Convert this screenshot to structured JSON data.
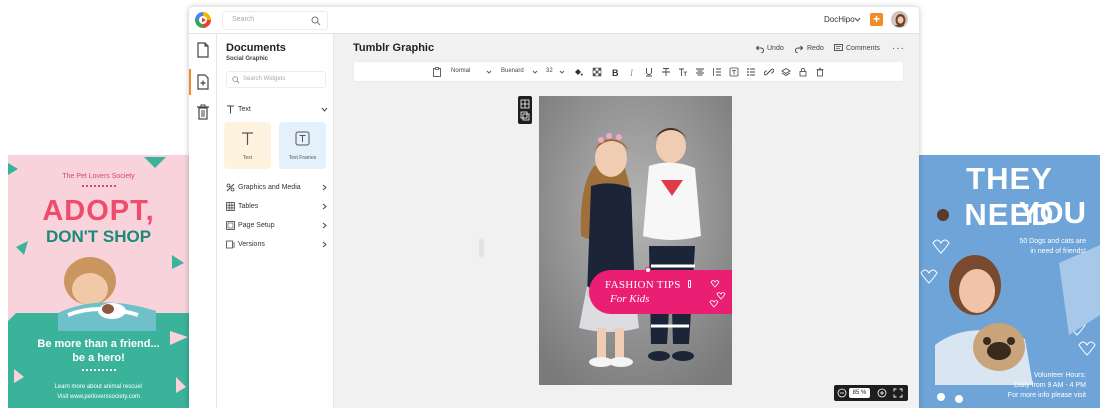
{
  "promo_left": {
    "society": "The Pet Lovers Society",
    "headline1": "ADOPT,",
    "headline2": "DON'T SHOP",
    "tagline1": "Be more than a friend...",
    "tagline2": "be a hero!",
    "learn1": "Learn more about animal rescue!",
    "learn2": "Visit www.petloverssociety.com"
  },
  "promo_right": {
    "headline1": "THEY NEED",
    "headline2": "YOU",
    "dogs1": "50 Dogs and cats are",
    "dogs2": "in need of friends!",
    "vol1": "Volunteer Hours:",
    "vol2": "Daily from 9 AM - 4 PM",
    "vol3": "For more info please visit"
  },
  "header": {
    "search_placeholder": "Search",
    "brand": "DocHipo",
    "add_label": "+"
  },
  "panel": {
    "title": "Documents",
    "subtitle": "Social Graphic",
    "search_placeholder": "Search Widgets",
    "text_section": "Text",
    "tiles": [
      {
        "label": "Text",
        "glyph": "T"
      },
      {
        "label": "Text Frames",
        "glyph": "T"
      }
    ],
    "sections": [
      "Graphics and Media",
      "Tables",
      "Page Setup",
      "Versions"
    ]
  },
  "workspace": {
    "title": "Tumblr Graphic",
    "undo": "Undo",
    "redo": "Redo",
    "comments": "Comments",
    "more": "···"
  },
  "toolbar": {
    "style": "Normal",
    "font": "Buenard",
    "size": "32"
  },
  "canvas": {
    "banner_line1": "FASHION TIPS",
    "banner_line2": "For Kids"
  },
  "zoom": {
    "value": "85 %"
  },
  "colors": {
    "accent": "#f28c28",
    "banner": "#ea1e73",
    "pink_card": "#f8d3dc",
    "green_card": "#3bb39a",
    "blue_card": "#6fa4d8"
  }
}
